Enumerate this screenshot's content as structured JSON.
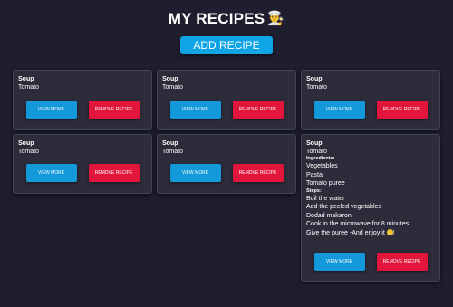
{
  "header": {
    "title": "MY RECIPES",
    "title_icon": "chef-icon",
    "add_button_label": "ADD RECIPE"
  },
  "cards": [
    {
      "title": "Soup",
      "subtitle": "Tomato",
      "view_label": "VIEW MORE",
      "remove_label": "REMOVE RECIPE"
    },
    {
      "title": "Soup",
      "subtitle": "Tomato",
      "view_label": "VIEW MORE",
      "remove_label": "REMOVE RECIPE"
    },
    {
      "title": "Soup",
      "subtitle": "Tomato",
      "view_label": "VIEW MORE",
      "remove_label": "REMOVE RECIPE"
    },
    {
      "title": "Soup",
      "subtitle": "Tomato",
      "view_label": "VIEW MORE",
      "remove_label": "REMOVE RECIPE"
    },
    {
      "title": "Soup",
      "subtitle": "Tomato",
      "view_label": "VIEW MORE",
      "remove_label": "REMOVE RECIPE"
    },
    {
      "title": "Soup",
      "subtitle": "Tomato",
      "ingredients_heading": "Ingredients:",
      "ingredients": [
        "Vegetables",
        "Pasta",
        "Tomato puree"
      ],
      "steps_heading": "Steps:",
      "steps": [
        "Boil the water",
        "Add the peeled vegetables",
        "Dodad makaron",
        "Cook in the microwave for 8 minutes",
        "Give the puree -And enjoy it"
      ],
      "steps_end_icon": "smiley-face-icon",
      "steps_end_text": "!",
      "view_label": "VIEW MORE",
      "remove_label": "REMOVE RECIPE"
    }
  ],
  "colors": {
    "background": "#1e1e2e",
    "card": "#2c2c3b",
    "view_button": "#1398da",
    "remove_button": "#e2163b",
    "add_button": "#0fa4e6"
  }
}
